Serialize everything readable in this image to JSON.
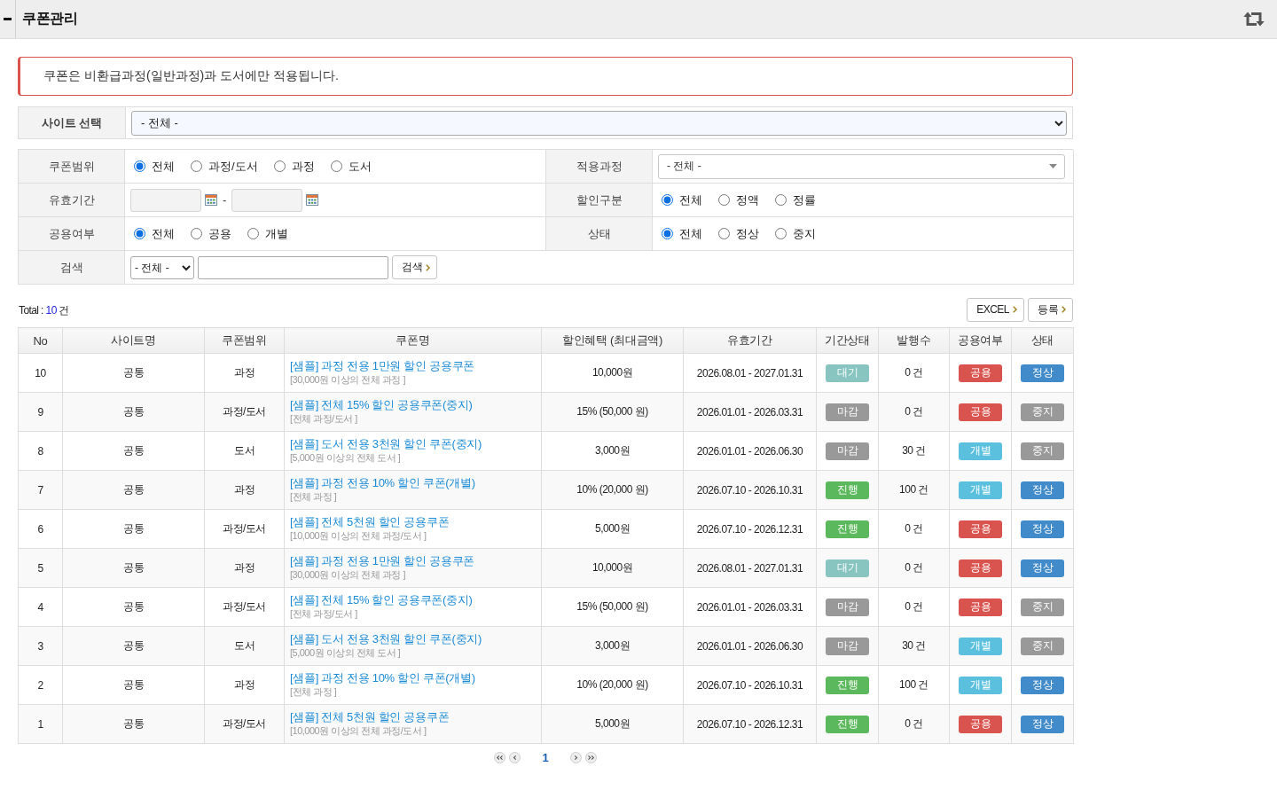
{
  "header": {
    "title": "쿠폰관리"
  },
  "notice": "쿠폰은 비환급과정(일반과정)과 도서에만 적용됩니다.",
  "site_select": {
    "label": "사이트 선택",
    "value": "- 전체 -"
  },
  "filters": [
    [
      {
        "label": "쿠폰범위",
        "kind": "radio",
        "options": [
          {
            "label": "전체",
            "selected": true
          },
          {
            "label": "과정/도서",
            "selected": false
          },
          {
            "label": "과정",
            "selected": false
          },
          {
            "label": "도서",
            "selected": false
          }
        ]
      },
      {
        "label": "적용과정",
        "kind": "dropdown",
        "value": "- 전체 -"
      }
    ],
    [
      {
        "label": "유효기간",
        "kind": "daterange",
        "separator": "-"
      },
      {
        "label": "할인구분",
        "kind": "radio",
        "options": [
          {
            "label": "전체",
            "selected": true
          },
          {
            "label": "정액",
            "selected": false
          },
          {
            "label": "정률",
            "selected": false
          }
        ]
      }
    ],
    [
      {
        "label": "공용여부",
        "kind": "radio",
        "options": [
          {
            "label": "전체",
            "selected": true
          },
          {
            "label": "공용",
            "selected": false
          },
          {
            "label": "개별",
            "selected": false
          }
        ]
      },
      {
        "label": "상태",
        "kind": "radio",
        "options": [
          {
            "label": "전체",
            "selected": true
          },
          {
            "label": "정상",
            "selected": false
          },
          {
            "label": "중지",
            "selected": false
          }
        ]
      }
    ],
    [
      {
        "label": "검색",
        "kind": "search",
        "select_value": "- 전체 -",
        "button": "검색"
      }
    ]
  ],
  "list": {
    "total_label": "Total :",
    "total": "10",
    "total_unit": "건",
    "buttons": [
      {
        "label": "EXCEL"
      },
      {
        "label": "등록"
      }
    ]
  },
  "table": {
    "columns": [
      "No",
      "사이트명",
      "쿠폰범위",
      "쿠폰명",
      "할인혜택 (최대금액)",
      "유효기간",
      "기간상태",
      "발행수",
      "공용여부",
      "상태"
    ],
    "rows": [
      {
        "no": "10",
        "site": "공통",
        "scope": "과정",
        "coupon": {
          "name": "[샘플] 과정 전용 1만원 할인 공용쿠폰",
          "condition": "[30,000원 이상의 전체 과정 ]"
        },
        "benefit": "10,000원",
        "period": "2026.08.01 - 2027.01.31",
        "period_status": {
          "label": "대기",
          "color": "#88c4c0"
        },
        "issued": "0 건",
        "shared": {
          "label": "공용",
          "color": "#d9534f"
        },
        "status": {
          "label": "정상",
          "color": "#428bca"
        }
      },
      {
        "no": "9",
        "site": "공통",
        "scope": "과정/도서",
        "coupon": {
          "name": "[샘플] 전체 15% 할인 공용쿠폰(중지)",
          "condition": "[전체 과정/도서 ]"
        },
        "benefit": "15% (50,000 원)",
        "period": "2026.01.01 - 2026.03.31",
        "period_status": {
          "label": "마감",
          "color": "#999999"
        },
        "issued": "0 건",
        "shared": {
          "label": "공용",
          "color": "#d9534f"
        },
        "status": {
          "label": "중지",
          "color": "#999999"
        }
      },
      {
        "no": "8",
        "site": "공통",
        "scope": "도서",
        "coupon": {
          "name": "[샘플] 도서 전용 3천원 할인 쿠폰(중지)",
          "condition": "[5,000원 이상의 전체 도서 ]"
        },
        "benefit": "3,000원",
        "period": "2026.01.01 - 2026.06.30",
        "period_status": {
          "label": "마감",
          "color": "#999999"
        },
        "issued": "30 건",
        "shared": {
          "label": "개별",
          "color": "#5bc0de"
        },
        "status": {
          "label": "중지",
          "color": "#999999"
        }
      },
      {
        "no": "7",
        "site": "공통",
        "scope": "과정",
        "coupon": {
          "name": "[샘플] 과정 전용 10% 할인 쿠폰(개별)",
          "condition": "[전체 과정 ]"
        },
        "benefit": "10% (20,000 원)",
        "period": "2026.07.10 - 2026.10.31",
        "period_status": {
          "label": "진행",
          "color": "#5cb85c"
        },
        "issued": "100 건",
        "shared": {
          "label": "개별",
          "color": "#5bc0de"
        },
        "status": {
          "label": "정상",
          "color": "#428bca"
        }
      },
      {
        "no": "6",
        "site": "공통",
        "scope": "과정/도서",
        "coupon": {
          "name": "[샘플] 전체 5천원 할인 공용쿠폰",
          "condition": "[10,000원 이상의 전체 과정/도서 ]"
        },
        "benefit": "5,000원",
        "period": "2026.07.10 - 2026.12.31",
        "period_status": {
          "label": "진행",
          "color": "#5cb85c"
        },
        "issued": "0 건",
        "shared": {
          "label": "공용",
          "color": "#d9534f"
        },
        "status": {
          "label": "정상",
          "color": "#428bca"
        }
      },
      {
        "no": "5",
        "site": "공통",
        "scope": "과정",
        "coupon": {
          "name": "[샘플] 과정 전용 1만원 할인 공용쿠폰",
          "condition": "[30,000원 이상의 전체 과정 ]"
        },
        "benefit": "10,000원",
        "period": "2026.08.01 - 2027.01.31",
        "period_status": {
          "label": "대기",
          "color": "#88c4c0"
        },
        "issued": "0 건",
        "shared": {
          "label": "공용",
          "color": "#d9534f"
        },
        "status": {
          "label": "정상",
          "color": "#428bca"
        }
      },
      {
        "no": "4",
        "site": "공통",
        "scope": "과정/도서",
        "coupon": {
          "name": "[샘플] 전체 15% 할인 공용쿠폰(중지)",
          "condition": "[전체 과정/도서 ]"
        },
        "benefit": "15% (50,000 원)",
        "period": "2026.01.01 - 2026.03.31",
        "period_status": {
          "label": "마감",
          "color": "#999999"
        },
        "issued": "0 건",
        "shared": {
          "label": "공용",
          "color": "#d9534f"
        },
        "status": {
          "label": "중지",
          "color": "#999999"
        }
      },
      {
        "no": "3",
        "site": "공통",
        "scope": "도서",
        "coupon": {
          "name": "[샘플] 도서 전용 3천원 할인 쿠폰(중지)",
          "condition": "[5,000원 이상의 전체 도서 ]"
        },
        "benefit": "3,000원",
        "period": "2026.01.01 - 2026.06.30",
        "period_status": {
          "label": "마감",
          "color": "#999999"
        },
        "issued": "30 건",
        "shared": {
          "label": "개별",
          "color": "#5bc0de"
        },
        "status": {
          "label": "중지",
          "color": "#999999"
        }
      },
      {
        "no": "2",
        "site": "공통",
        "scope": "과정",
        "coupon": {
          "name": "[샘플] 과정 전용 10% 할인 쿠폰(개별)",
          "condition": "[전체 과정 ]"
        },
        "benefit": "10% (20,000 원)",
        "period": "2026.07.10 - 2026.10.31",
        "period_status": {
          "label": "진행",
          "color": "#5cb85c"
        },
        "issued": "100 건",
        "shared": {
          "label": "개별",
          "color": "#5bc0de"
        },
        "status": {
          "label": "정상",
          "color": "#428bca"
        }
      },
      {
        "no": "1",
        "site": "공통",
        "scope": "과정/도서",
        "coupon": {
          "name": "[샘플] 전체 5천원 할인 공용쿠폰",
          "condition": "[10,000원 이상의 전체 과정/도서 ]"
        },
        "benefit": "5,000원",
        "period": "2026.07.10 - 2026.12.31",
        "period_status": {
          "label": "진행",
          "color": "#5cb85c"
        },
        "issued": "0 건",
        "shared": {
          "label": "공용",
          "color": "#d9534f"
        },
        "status": {
          "label": "정상",
          "color": "#428bca"
        }
      }
    ]
  },
  "pagination": {
    "pages": [
      {
        "label": "1",
        "selected": true
      }
    ]
  }
}
